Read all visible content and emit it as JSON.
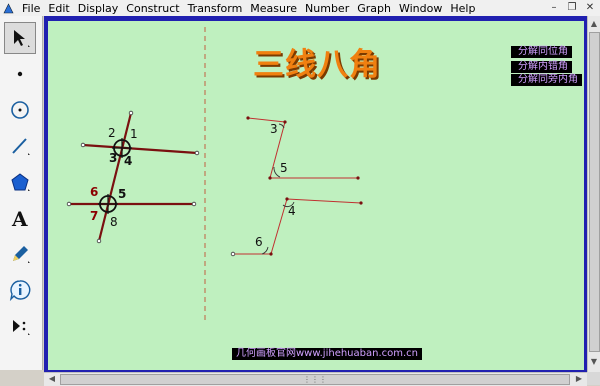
{
  "menu": {
    "items": [
      "File",
      "Edit",
      "Display",
      "Construct",
      "Transform",
      "Measure",
      "Number",
      "Graph",
      "Window",
      "Help"
    ]
  },
  "toolbox": {
    "tools": [
      "arrow-select-tool",
      "point-tool",
      "compass-tool",
      "straightedge-tool",
      "polygon-tool",
      "text-tool",
      "marker-tool",
      "information-tool",
      "custom-tool"
    ]
  },
  "canvas": {
    "title": "三线八角",
    "buttons": [
      "分解同位角",
      "分解内错角",
      "分解同旁内角"
    ],
    "footer": "几何画板官网www.jihehuaban.com.cn",
    "left_figure_labels": [
      "1",
      "2",
      "3",
      "4",
      "5",
      "6",
      "7",
      "8"
    ],
    "right_figure_labels": [
      "3",
      "5",
      "4",
      "6"
    ]
  },
  "colors": {
    "canvas_bg": "#bff0bf",
    "frame": "#2020b0",
    "title": "#f08010",
    "button_bg": "#000000",
    "button_text": "#d0a0ff",
    "line_dark": "#7a1010",
    "line_light": "#c03030"
  }
}
